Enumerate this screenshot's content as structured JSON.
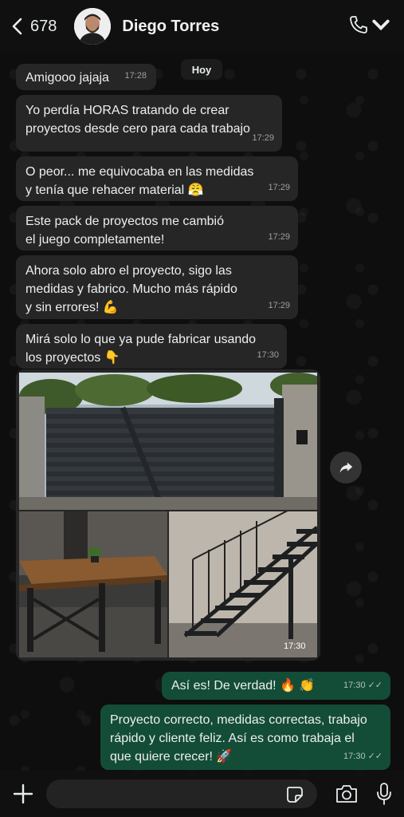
{
  "header": {
    "unread_count": "678",
    "contact_name": "Diego Torres"
  },
  "date_chip": "Hoy",
  "messages": [
    {
      "text_lines": [
        "Amigooo jajaja"
      ],
      "time": "17:28"
    },
    {
      "text_lines": [
        "Yo perdía HORAS tratando de crear",
        "proyectos desde cero para cada trabajo"
      ],
      "time": "17:29"
    },
    {
      "text_lines": [
        "O peor... me equivocaba en las medidas",
        "y tenía que rehacer material 😤"
      ],
      "time": "17:29"
    },
    {
      "text_lines": [
        "Este pack de proyectos me cambió",
        "el juego completamente!"
      ],
      "time": "17:29"
    },
    {
      "text_lines": [
        "Ahora solo abro el proyecto, sigo las",
        "medidas y fabrico. Mucho más rápido",
        "y sin errores! 💪"
      ],
      "time": "17:29"
    },
    {
      "text_lines": [
        "Mirá solo lo que ya pude fabricar usando",
        "los proyectos 👇"
      ],
      "time": "17:30"
    }
  ],
  "media_message": {
    "time": "17:30",
    "photos": [
      "metal-gate-photo",
      "wood-table-photo",
      "metal-staircase-photo"
    ]
  },
  "outgoing": [
    {
      "text_lines": [
        "Así es! De verdad! 🔥 👏"
      ],
      "time": "17:30"
    },
    {
      "text_lines": [
        "Proyecto correcto, medidas correctas, trabajo",
        "rápido y cliente feliz. Así es como trabaja el",
        "que quiere crecer! 🚀"
      ],
      "time": "17:30"
    }
  ],
  "footer": {
    "input_value": ""
  },
  "colors": {
    "incoming_bubble": "#262626",
    "outgoing_bubble": "#144d37",
    "background": "#0e0e0e"
  }
}
